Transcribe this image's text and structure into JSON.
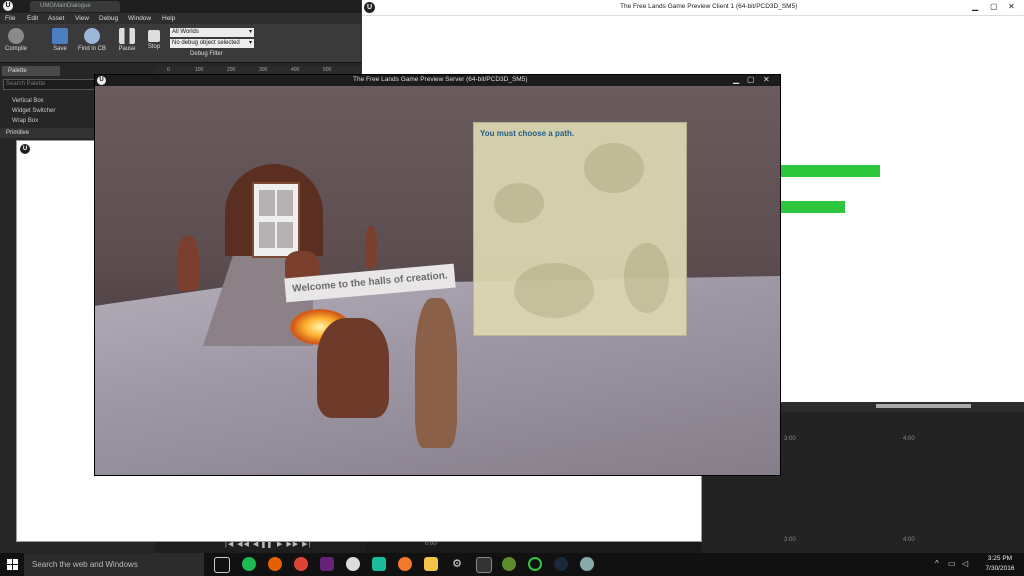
{
  "editor": {
    "doc_tab": "UMGMainDialogue",
    "menu": [
      "File",
      "Edit",
      "Asset",
      "View",
      "Debug",
      "Window",
      "Help"
    ],
    "toolbar": {
      "compile": "Compile",
      "save": "Save",
      "find": "Find in CB",
      "pause": "Pause",
      "stop": "Stop"
    },
    "worlds_dropdown": "All Worlds",
    "debug_dropdown": "No debug object selected",
    "debug_filter": "Debug Filter",
    "ruler_ticks": [
      "0",
      "100",
      "200",
      "300",
      "400",
      "500"
    ],
    "palette_tab": "Palette",
    "palette_search_placeholder": "Search Palette",
    "palette_items": [
      "Vertical Box",
      "Widget Switcher",
      "Wrap Box"
    ],
    "primitive_header": "Primitive",
    "transport": "|◀ ◀◀ ◀ ▌▌ ▶ ▶▶ ▶|",
    "transport_time": "0:00"
  },
  "client": {
    "title": "The Free Lands Game Preview Client 1 (64-bit/PCD3D_SM5)",
    "health_bars_color": "#2ec63c"
  },
  "server": {
    "title": "The Free Lands Game Preview Server (64-bit/PCD3D_SM5)",
    "welcome_sign": "Welcome to the halls of creation.",
    "dialog_text": "You must choose a path."
  },
  "timeline": {
    "labels": [
      "3:00",
      "4:00",
      "3:00",
      "4:00"
    ]
  },
  "taskbar": {
    "search": "Search the web and Windows",
    "time": "3:25 PM",
    "date": "7/30/2016"
  }
}
